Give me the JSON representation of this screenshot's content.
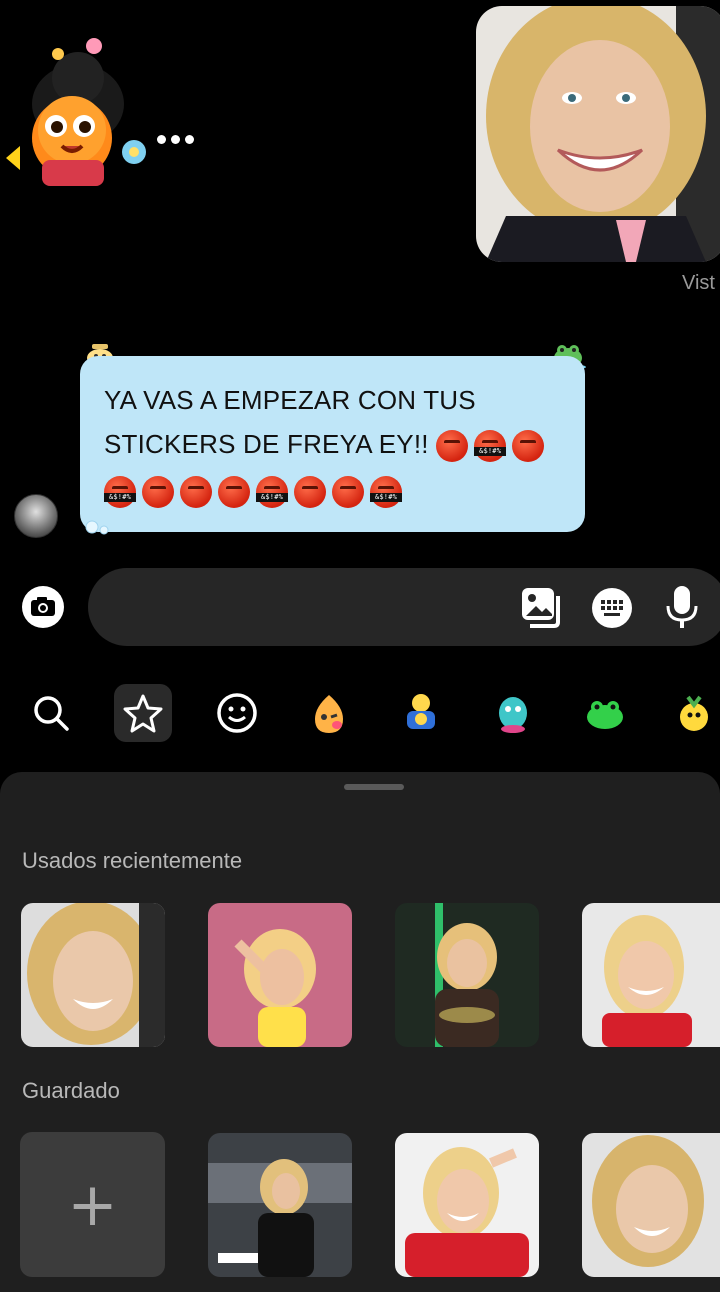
{
  "chat": {
    "seen_label": "Vist",
    "message_text": "YA VAS A EMPEZAR CON TUS STICKERS DE FREYA EY!!",
    "angry_emoji_count_line1": 3,
    "angry_emoji_count_line2": 8
  },
  "icons": {
    "camera": "camera-icon",
    "gallery": "gallery-icon",
    "keyboard": "keyboard-icon",
    "mic": "microphone-icon",
    "search": "search-icon",
    "star": "star-icon",
    "emoji": "smiley-icon"
  },
  "sheet": {
    "recent_title": "Usados recientemente",
    "saved_title": "Guardado",
    "add_symbol": "+"
  },
  "colors": {
    "bubble": "#bfe6f8",
    "background": "#000000",
    "sheet": "#1f1f1f",
    "input": "#262626"
  }
}
